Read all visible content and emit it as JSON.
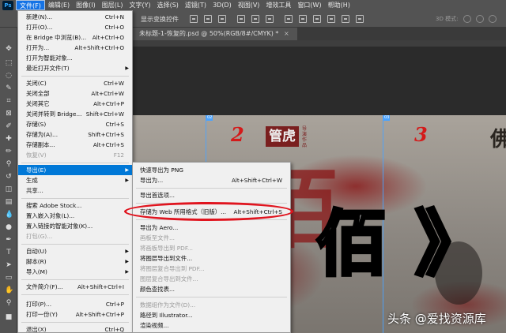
{
  "app": {
    "logo": "Ps",
    "menus": [
      "文件(F)",
      "编辑(E)",
      "图像(I)",
      "图层(L)",
      "文字(Y)",
      "选择(S)",
      "滤镜(T)",
      "3D(D)",
      "视图(V)",
      "增效工具",
      "窗口(W)",
      "帮助(H)"
    ],
    "active_menu": "文件(F)"
  },
  "options_bar": {
    "label": "显示变换控件",
    "mode_3d": "3D 模式:"
  },
  "document": {
    "tab_title": "未标题-1-恢复的.psd @ 50%(RGB/8#/CMYK) *",
    "close": "×"
  },
  "canvas": {
    "guides": [
      "02",
      "03"
    ],
    "numbers": [
      "2",
      "3"
    ],
    "seal_text": "管虎",
    "seal_side": "导演作品",
    "big_chars": [
      "佰",
      "》"
    ],
    "red_char": "佰",
    "edge_char": "佛"
  },
  "file_menu": {
    "items": [
      {
        "label": "新建(N)...",
        "shortcut": "Ctrl+N"
      },
      {
        "label": "打开(O)...",
        "shortcut": "Ctrl+O"
      },
      {
        "label": "在 Bridge 中浏览(B)...",
        "shortcut": "Alt+Ctrl+O"
      },
      {
        "label": "打开为...",
        "shortcut": "Alt+Shift+Ctrl+O"
      },
      {
        "label": "打开为智能对象...",
        "shortcut": ""
      },
      {
        "label": "最近打开文件(T)",
        "shortcut": "",
        "submenu": true
      },
      {
        "label": "关闭(C)",
        "shortcut": "Ctrl+W"
      },
      {
        "label": "关闭全部",
        "shortcut": "Alt+Ctrl+W"
      },
      {
        "label": "关闭其它",
        "shortcut": "Alt+Ctrl+P"
      },
      {
        "label": "关闭并转到 Bridge...",
        "shortcut": "Shift+Ctrl+W"
      },
      {
        "label": "存储(S)",
        "shortcut": "Ctrl+S"
      },
      {
        "label": "存储为(A)...",
        "shortcut": "Shift+Ctrl+S"
      },
      {
        "label": "存储副本...",
        "shortcut": "Alt+Ctrl+S"
      },
      {
        "label": "恢复(V)",
        "shortcut": "F12",
        "disabled": true
      },
      {
        "label": "导出(E)",
        "shortcut": "",
        "submenu": true,
        "highlight": true
      },
      {
        "label": "生成",
        "shortcut": "",
        "submenu": true
      },
      {
        "label": "共享...",
        "shortcut": ""
      },
      {
        "label": "搜索 Adobe Stock...",
        "shortcut": ""
      },
      {
        "label": "置入嵌入对象(L)...",
        "shortcut": ""
      },
      {
        "label": "置入链接的智能对象(K)...",
        "shortcut": ""
      },
      {
        "label": "打包(G)...",
        "shortcut": "",
        "disabled": true
      },
      {
        "label": "自动(U)",
        "shortcut": "",
        "submenu": true
      },
      {
        "label": "脚本(R)",
        "shortcut": "",
        "submenu": true
      },
      {
        "label": "导入(M)",
        "shortcut": "",
        "submenu": true
      },
      {
        "label": "文件简介(F)...",
        "shortcut": "Alt+Shift+Ctrl+I"
      },
      {
        "label": "打印(P)...",
        "shortcut": "Ctrl+P"
      },
      {
        "label": "打印一份(Y)",
        "shortcut": "Alt+Shift+Ctrl+P"
      },
      {
        "label": "退出(X)",
        "shortcut": "Ctrl+Q"
      }
    ]
  },
  "export_menu": {
    "items": [
      {
        "label": "快速导出为 PNG",
        "shortcut": ""
      },
      {
        "label": "导出为...",
        "shortcut": "Alt+Shift+Ctrl+W"
      },
      {
        "label": "导出首选项...",
        "shortcut": ""
      },
      {
        "label": "存储为 Web 所用格式（旧版）...",
        "shortcut": "Alt+Shift+Ctrl+S"
      },
      {
        "label": "导出为 Aero...",
        "shortcut": ""
      },
      {
        "label": "画板至文件...",
        "shortcut": "",
        "disabled": true
      },
      {
        "label": "将画板导出到 PDF...",
        "shortcut": "",
        "disabled": true
      },
      {
        "label": "将图层导出到文件...",
        "shortcut": ""
      },
      {
        "label": "将图层复合导出到 PDF...",
        "shortcut": "",
        "disabled": true
      },
      {
        "label": "图层复合导出到文件...",
        "shortcut": "",
        "disabled": true
      },
      {
        "label": "颜色查找表...",
        "shortcut": ""
      },
      {
        "label": "数据组作为文件(D)...",
        "shortcut": "",
        "disabled": true
      },
      {
        "label": "路径到 Illustrator...",
        "shortcut": ""
      },
      {
        "label": "渲染视频...",
        "shortcut": ""
      }
    ]
  },
  "watermark": "头条 @爱找资源库",
  "colors": {
    "menu_highlight": "#0078d7",
    "annotation_red": "#e0141e",
    "guide_blue": "#4aa3ff"
  }
}
